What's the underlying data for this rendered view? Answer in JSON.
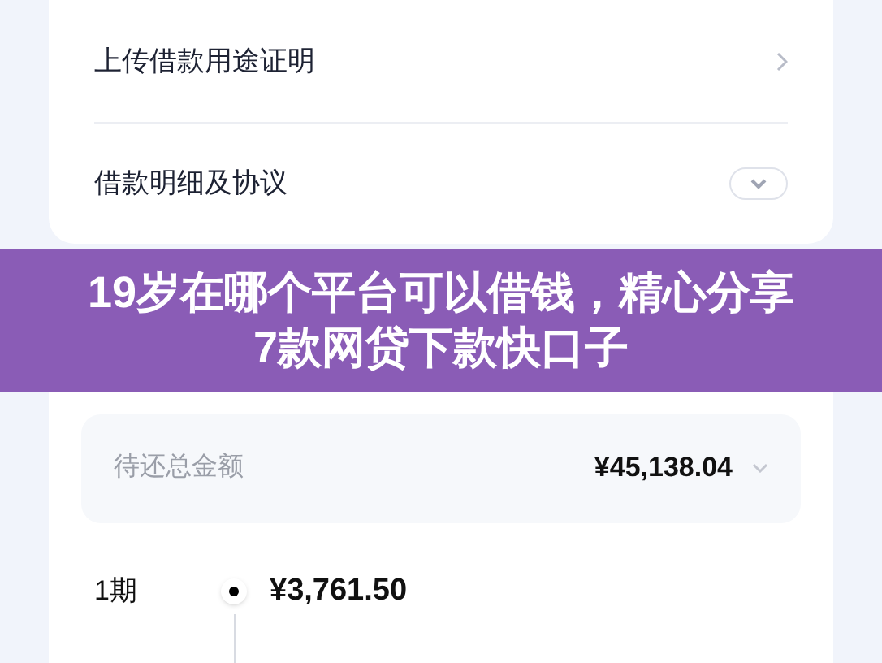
{
  "menu_rows": [
    {
      "kind": "link",
      "label": "上传借款用途证明"
    },
    {
      "kind": "expand",
      "label": "借款明细及协议",
      "expanded": false
    }
  ],
  "banner": {
    "title": "19岁在哪个平台可以借钱，精心分享7款网贷下款快口子"
  },
  "summary": {
    "label": "待还总金额",
    "amount": "¥45,138.04"
  },
  "installments": [
    {
      "period": "1期",
      "amount": "¥3,761.50"
    }
  ]
}
